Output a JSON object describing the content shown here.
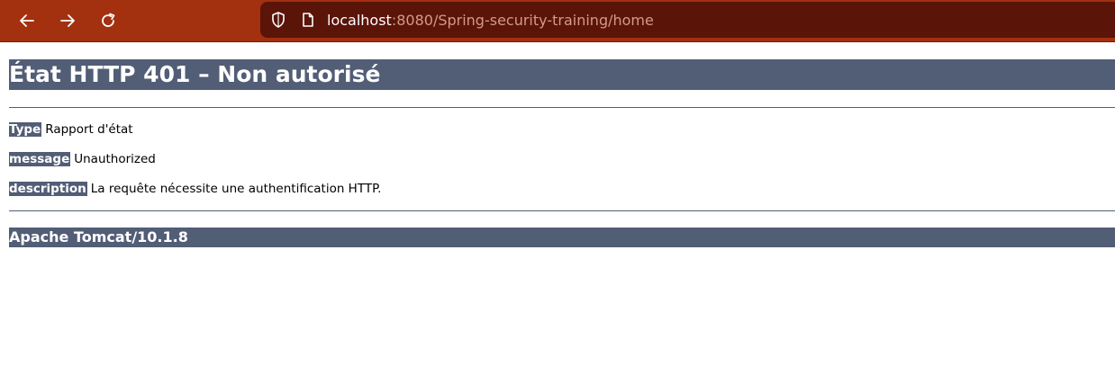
{
  "browser": {
    "back_icon": "arrow-left-icon",
    "forward_icon": "arrow-right-icon",
    "reload_icon": "reload-icon",
    "shield_icon": "tracking-protection-shield-icon",
    "page_icon": "page-info-icon",
    "url_host": "localhost",
    "url_rest": ":8080/Spring-security-training/home",
    "colors": {
      "toolbar": "#a3300f",
      "urlbar": "#5a1408"
    }
  },
  "page": {
    "title": "État HTTP 401 – Non autorisé",
    "rows": [
      {
        "label": "Type",
        "value": "Rapport d'état"
      },
      {
        "label": "message",
        "value": "Unauthorized"
      },
      {
        "label": "description",
        "value": "La requête nécessite une authentification HTTP."
      }
    ],
    "footer": "Apache Tomcat/10.1.8",
    "accent": "#525d76"
  }
}
